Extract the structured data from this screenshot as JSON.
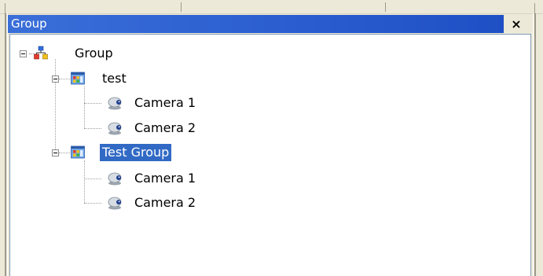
{
  "panel": {
    "title": "Group",
    "close_label": "×"
  },
  "tree": {
    "root": {
      "label": "Group",
      "icon": "network-group-icon",
      "expanded": true,
      "children": [
        {
          "label": "test",
          "icon": "group-folder-icon",
          "expanded": true,
          "selected": false,
          "children": [
            {
              "label": "Camera 1",
              "icon": "camera-icon"
            },
            {
              "label": "Camera 2",
              "icon": "camera-icon"
            }
          ]
        },
        {
          "label": "Test Group",
          "icon": "group-folder-icon",
          "expanded": true,
          "selected": true,
          "children": [
            {
              "label": "Camera 1",
              "icon": "camera-icon"
            },
            {
              "label": "Camera 2",
              "icon": "camera-icon"
            }
          ]
        }
      ]
    }
  },
  "colors": {
    "title_bar": "#2a5ccf",
    "selection": "#316ac5",
    "chrome": "#ece9d8"
  }
}
